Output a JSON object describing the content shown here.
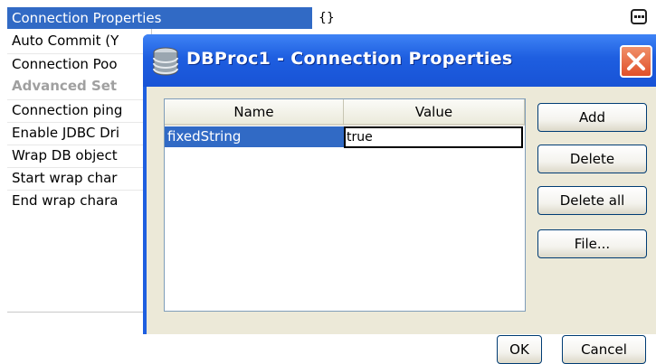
{
  "property_sheet": {
    "selected_row": {
      "label": "Connection Properties",
      "value": "{}"
    },
    "rows": [
      {
        "label": "Auto Commit (Y"
      },
      {
        "label": "Connection Poo"
      },
      {
        "label": "Advanced Set",
        "category": true
      },
      {
        "label": "Connection ping"
      },
      {
        "label": "Enable JDBC Dri"
      },
      {
        "label": "Wrap DB object"
      },
      {
        "label": "Start wrap char"
      },
      {
        "label": "End wrap chara"
      }
    ],
    "ellipsis_icon": "ellipsis-icon"
  },
  "dialog": {
    "title": "DBProc1 - Connection Properties",
    "title_icon": "database-icon",
    "close_icon": "close-x-icon",
    "table": {
      "columns": [
        "Name",
        "Value"
      ],
      "rows": [
        {
          "name": "fixedString",
          "value": "true"
        }
      ]
    },
    "buttons": {
      "add": "Add",
      "delete": "Delete",
      "delete_all": "Delete all",
      "file": "File...",
      "ok": "OK",
      "cancel": "Cancel"
    },
    "colors": {
      "titlebar": "#1f5fe0",
      "selection": "#316ac5",
      "client_bg": "#ece9d8",
      "close": "#e0502a"
    }
  }
}
